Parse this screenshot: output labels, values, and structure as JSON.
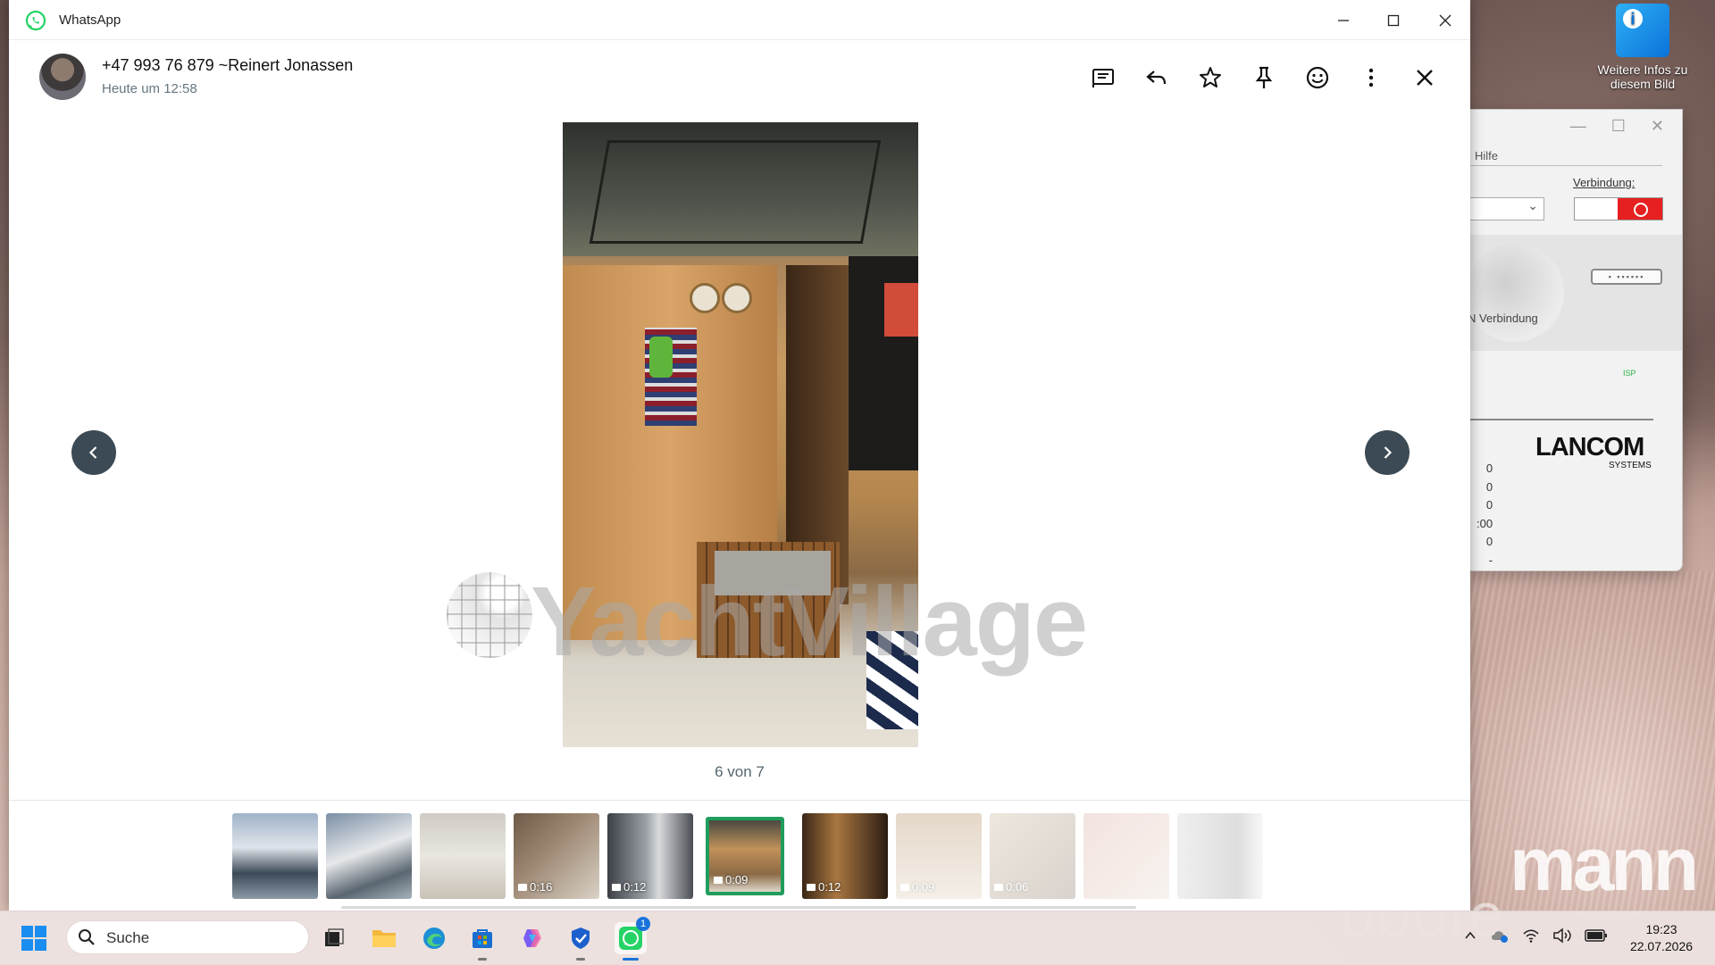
{
  "window": {
    "app_title": "WhatsApp",
    "accent_color": "#25D366",
    "selected_color": "#1f9d5c"
  },
  "header": {
    "contact_name": "+47 993 76 879 ~Reinert Jonassen",
    "timestamp": "Heute um 12:58",
    "actions": [
      "message-icon",
      "reply-icon",
      "star-icon",
      "pin-icon",
      "emoji-icon",
      "more-icon",
      "close-icon"
    ]
  },
  "viewer": {
    "counter": "6 von 7",
    "watermark": "YachtVillage"
  },
  "thumbnails": [
    {
      "duration": "",
      "selected": false,
      "dim": false
    },
    {
      "duration": "",
      "selected": false,
      "dim": false
    },
    {
      "duration": "",
      "selected": false,
      "dim": false
    },
    {
      "duration": "0:16",
      "selected": false,
      "dim": false
    },
    {
      "duration": "0:12",
      "selected": false,
      "dim": false
    },
    {
      "duration": "0:09",
      "selected": true,
      "dim": false
    },
    {
      "duration": "0:12",
      "selected": false,
      "dim": false
    },
    {
      "duration": "0:09",
      "selected": false,
      "dim": true
    },
    {
      "duration": "0:06",
      "selected": false,
      "dim": true
    },
    {
      "duration": "",
      "selected": false,
      "dim": true
    },
    {
      "duration": "",
      "selected": false,
      "dim": true
    }
  ],
  "desktop": {
    "icon_label": "Weitere Infos zu diesem Bild",
    "brand_text": "mann",
    "brand_text2": "boote"
  },
  "lancom": {
    "menu": "Hilfe",
    "connection_label": "Verbindung:",
    "vpn_label": "N Verbindung",
    "isp_label": "ISP",
    "logo": "LANCOM",
    "logo_sub": "SYSTEMS",
    "stats": [
      "0",
      "0",
      "0",
      ":00",
      "0",
      "-"
    ]
  },
  "taskbar": {
    "search_label": "Suche",
    "whatsapp_badge": "1",
    "time": "19:23",
    "date": "22.07.2026"
  }
}
